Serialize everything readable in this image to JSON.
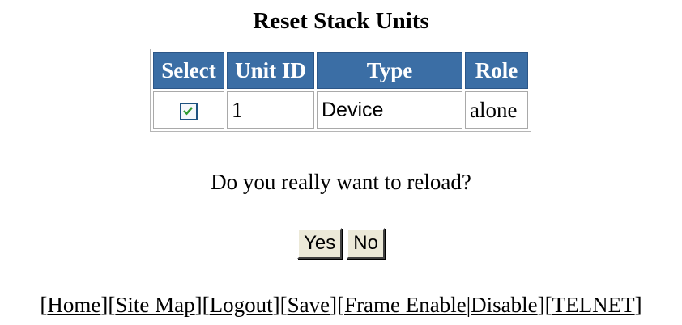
{
  "page": {
    "title": "Reset Stack Units",
    "question": "Do you really want to reload?"
  },
  "table": {
    "headers": {
      "select": "Select",
      "unit_id": "Unit ID",
      "type": "Type",
      "role": "Role"
    },
    "rows": [
      {
        "selected": true,
        "unit_id": "1",
        "type": "Device",
        "role": "alone"
      }
    ]
  },
  "buttons": {
    "yes": "Yes",
    "no": "No"
  },
  "footer": {
    "home": "Home",
    "site_map": "Site Map",
    "logout": "Logout",
    "save": "Save",
    "frame_enable": "Frame Enable",
    "disable": "Disable",
    "telnet": "TELNET"
  },
  "colors": {
    "header_bg": "#3b6ea5",
    "header_text": "#ffffff",
    "check_color": "#2e9b2e"
  }
}
